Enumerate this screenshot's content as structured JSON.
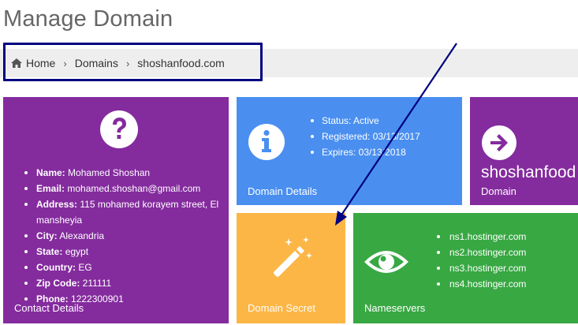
{
  "page": {
    "title": "Manage Domain"
  },
  "breadcrumb": {
    "home": "Home",
    "domains": "Domains",
    "current": "shoshanfood.com"
  },
  "contact": {
    "title": "Contact Details",
    "fields": [
      {
        "label": "Name:",
        "value": "Mohamed Shoshan"
      },
      {
        "label": "Email:",
        "value": "mohamed.shoshan@gmail.com"
      },
      {
        "label": "Address:",
        "value": "115 mohamed korayem street, El mansheyia"
      },
      {
        "label": "City:",
        "value": "Alexandria"
      },
      {
        "label": "State:",
        "value": "egypt"
      },
      {
        "label": "Country:",
        "value": "EG"
      },
      {
        "label": "Zip Code:",
        "value": "211111"
      },
      {
        "label": "Phone:",
        "value": "1222300901"
      }
    ]
  },
  "details": {
    "title": "Domain Details",
    "status": "Status: Active",
    "registered": "Registered: 03/13/2017",
    "expires": "Expires: 03/13/2018"
  },
  "domain": {
    "name": "shoshanfood",
    "title": "Domain"
  },
  "secret": {
    "title": "Domain Secret"
  },
  "nameservers": {
    "title": "Nameservers",
    "items": [
      "ns1.hostinger.com",
      "ns2.hostinger.com",
      "ns3.hostinger.com",
      "ns4.hostinger.com"
    ]
  },
  "colors": {
    "purple": "#842b9e",
    "blue": "#4a8ff0",
    "orange": "#fcb646",
    "green": "#38a843",
    "annotation": "#000080",
    "breadcrumb_bg": "#eeeeee"
  },
  "icons": {
    "home": "home-icon",
    "contact": "question-circle-icon",
    "details": "info-circle-icon",
    "domain": "arrow-circle-right-icon",
    "secret": "magic-wand-icon",
    "nameservers": "eye-icon"
  }
}
